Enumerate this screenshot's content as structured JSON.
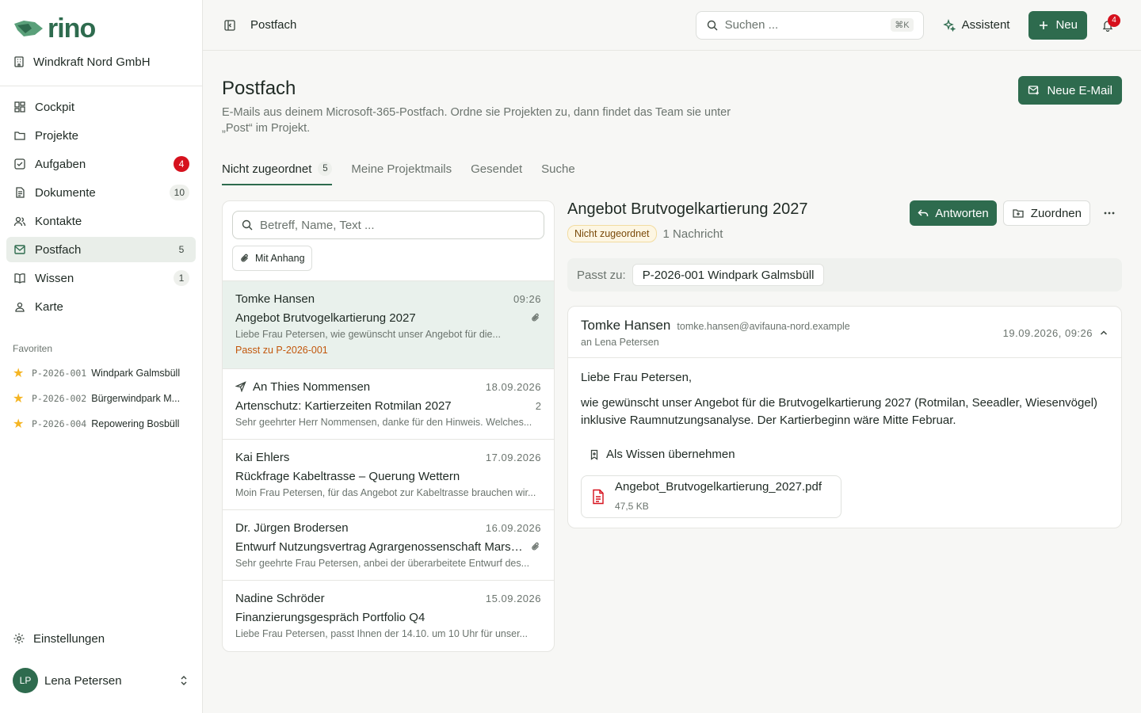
{
  "brand": {
    "name": "rino",
    "color": "#2e6b4e"
  },
  "org": {
    "name": "Windkraft Nord GmbH"
  },
  "nav": [
    {
      "label": "Cockpit",
      "icon": "grid-icon",
      "badge": ""
    },
    {
      "label": "Projekte",
      "icon": "folder-icon",
      "badge": ""
    },
    {
      "label": "Aufgaben",
      "icon": "checkbox-icon",
      "badge": "4",
      "badge_style": "red"
    },
    {
      "label": "Dokumente",
      "icon": "document-icon",
      "badge": "10"
    },
    {
      "label": "Kontakte",
      "icon": "people-icon",
      "badge": ""
    },
    {
      "label": "Postfach",
      "icon": "mail-icon",
      "badge": "5",
      "active": true
    },
    {
      "label": "Wissen",
      "icon": "book-icon",
      "badge": "1"
    },
    {
      "label": "Karte",
      "icon": "map-pin-icon",
      "badge": ""
    }
  ],
  "favorites": {
    "title": "Favoriten",
    "items": [
      {
        "code": "P-2026-001",
        "name": "Windpark Galmsbüll"
      },
      {
        "code": "P-2026-002",
        "name": "Bürgerwindpark M..."
      },
      {
        "code": "P-2026-004",
        "name": "Repowering Bosbüll"
      }
    ]
  },
  "settings_label": "Einstellungen",
  "user": {
    "initials": "LP",
    "name": "Lena Petersen"
  },
  "topbar": {
    "breadcrumb": "Postfach",
    "search_placeholder": "Suchen ...",
    "search_shortcut": "⌘K",
    "assistant_label": "Assistent",
    "new_label": "Neu",
    "notifications_count": "4"
  },
  "page": {
    "title": "Postfach",
    "subtitle": "E-Mails aus deinem Microsoft-365-Postfach. Ordne sie Projekten zu, dann findet das Team sie unter „Post“ im Projekt.",
    "new_mail_label": "Neue E-Mail"
  },
  "tabs": [
    {
      "label": "Nicht zugeordnet",
      "count": "5",
      "active": true
    },
    {
      "label": "Meine Projektmails",
      "count": ""
    },
    {
      "label": "Gesendet",
      "count": ""
    },
    {
      "label": "Suche",
      "count": ""
    }
  ],
  "list": {
    "search_placeholder": "Betreff, Name, Text ...",
    "filter_chip": "Mit Anhang",
    "items": [
      {
        "from": "Tomke Hansen",
        "date": "09:26",
        "subject": "Angebot Brutvogelkartierung 2027",
        "preview": "Liebe Frau Petersen, wie gewünscht unser Angebot für die...",
        "match": "Passt zu P-2026-001",
        "attachment": true,
        "sent": false,
        "meta": ""
      },
      {
        "from": "An Thies Nommensen",
        "date": "18.09.2026",
        "subject": "Artenschutz: Kartierzeiten Rotmilan 2027",
        "preview": "Sehr geehrter Herr Nommensen, danke für den Hinweis. Welches...",
        "match": "",
        "attachment": false,
        "sent": true,
        "meta": "2"
      },
      {
        "from": "Kai Ehlers",
        "date": "17.09.2026",
        "subject": "Rückfrage Kabeltrasse – Querung Wettern",
        "preview": "Moin Frau Petersen, für das Angebot zur Kabeltrasse brauchen wir...",
        "match": "",
        "attachment": false,
        "sent": false,
        "meta": ""
      },
      {
        "from": "Dr. Jürgen Brodersen",
        "date": "16.09.2026",
        "subject": "Entwurf Nutzungsvertrag Agrargenossenschaft Marsch...",
        "preview": "Sehr geehrte Frau Petersen, anbei der überarbeitete Entwurf des...",
        "match": "",
        "attachment": true,
        "sent": false,
        "meta": ""
      },
      {
        "from": "Nadine Schröder",
        "date": "15.09.2026",
        "subject": "Finanzierungsgespräch Portfolio Q4",
        "preview": "Liebe Frau Petersen, passt Ihnen der 14.10. um 10 Uhr für unser...",
        "match": "",
        "attachment": false,
        "sent": false,
        "meta": ""
      }
    ]
  },
  "detail": {
    "title": "Angebot Brutvogelkartierung 2027",
    "status": "Nicht zugeordnet",
    "message_count": "1 Nachricht",
    "reply_label": "Antworten",
    "assign_label": "Zuordnen",
    "match_label": "Passt zu:",
    "match_project": "P-2026-001 Windpark Galmsbüll",
    "message": {
      "from_name": "Tomke Hansen",
      "from_email": "tomke.hansen@avifauna-nord.example",
      "to": "an Lena Petersen",
      "date": "19.09.2026, 09:26",
      "greeting": "Liebe Frau Petersen,",
      "body": "wie gewünscht unser Angebot für die Brutvogelkartierung 2027 (Rotmilan, Seeadler, Wiesenvögel) inklusive Raumnutzungsanalyse. Der Kartierbeginn wäre Mitte Februar.",
      "knowledge_label": "Als Wissen übernehmen",
      "attachment_name": "Angebot_Brutvogelkartierung_2027.pdf",
      "attachment_size": "47,5 KB"
    }
  }
}
